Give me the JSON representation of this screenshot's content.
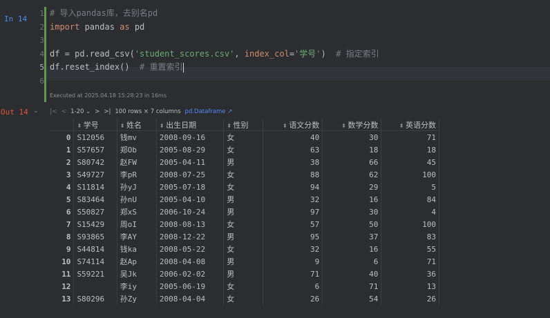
{
  "input_cell": {
    "prompt": "In 14",
    "line_numbers": [
      "1",
      "2",
      "3",
      "4",
      "5",
      "6"
    ],
    "lines": [
      [
        {
          "t": "# 导入pandas库，去别名pd",
          "c": "c-com"
        }
      ],
      [
        {
          "t": "import",
          "c": "c-kw"
        },
        {
          "t": " pandas ",
          "c": "c-norm"
        },
        {
          "t": "as",
          "c": "c-kw"
        },
        {
          "t": " pd",
          "c": "c-norm"
        }
      ],
      [],
      [
        {
          "t": "df = pd.read_csv(",
          "c": "c-norm"
        },
        {
          "t": "'student_scores.csv'",
          "c": "c-str"
        },
        {
          "t": ", ",
          "c": "c-norm"
        },
        {
          "t": "index_col",
          "c": "c-param"
        },
        {
          "t": "=",
          "c": "c-norm"
        },
        {
          "t": "'学号'",
          "c": "c-str"
        },
        {
          "t": ")  ",
          "c": "c-norm"
        },
        {
          "t": "# 指定索引",
          "c": "c-com"
        }
      ],
      [
        {
          "t": "df.reset_index()  ",
          "c": "c-norm"
        },
        {
          "t": "# 重置索引",
          "c": "c-com"
        }
      ],
      []
    ],
    "executed": "Executed at 2025.04.18 15:28:23 in 16ms"
  },
  "output_cell": {
    "prompt": "Out 14",
    "collapse_icon": "chevron-down-icon",
    "toolbar": {
      "first": "|<",
      "prev": "<",
      "page_range": "1-20",
      "next": ">",
      "last": ">|",
      "summary": "100 rows × 7 columns",
      "type_link": "pd.Dataframe ↗"
    },
    "columns": [
      "",
      "学号",
      "姓名",
      "出生日期",
      "性别",
      "语文分数",
      "数学分数",
      "英语分数"
    ],
    "rows": [
      [
        "0",
        "S12056",
        "钱mv",
        "2008-09-16",
        "女",
        "40",
        "30",
        "71"
      ],
      [
        "1",
        "S57657",
        "郑Ob",
        "2005-08-29",
        "女",
        "63",
        "18",
        "18"
      ],
      [
        "2",
        "S80742",
        "赵FW",
        "2005-04-11",
        "男",
        "38",
        "66",
        "45"
      ],
      [
        "3",
        "S49727",
        "李pR",
        "2008-07-25",
        "女",
        "88",
        "62",
        "100"
      ],
      [
        "4",
        "S11814",
        "孙yJ",
        "2005-07-18",
        "女",
        "94",
        "29",
        "5"
      ],
      [
        "5",
        "S83464",
        "孙nU",
        "2005-04-10",
        "男",
        "32",
        "16",
        "84"
      ],
      [
        "6",
        "S50827",
        "郑xS",
        "2006-10-24",
        "男",
        "97",
        "30",
        "4"
      ],
      [
        "7",
        "S15429",
        "周oI",
        "2008-08-13",
        "女",
        "57",
        "50",
        "100"
      ],
      [
        "8",
        "S93865",
        "李AY",
        "2008-12-22",
        "男",
        "95",
        "37",
        "83"
      ],
      [
        "9",
        "S44814",
        "钱ka",
        "2008-05-22",
        "女",
        "32",
        "16",
        "55"
      ],
      [
        "10",
        "S74114",
        "赵Ap",
        "2008-04-08",
        "男",
        "9",
        "6",
        "71"
      ],
      [
        "11",
        "S59221",
        "吴Jk",
        "2006-02-02",
        "男",
        "71",
        "40",
        "36"
      ],
      [
        "12",
        "",
        "李iy",
        "2005-06-19",
        "女",
        "6",
        "71",
        "13"
      ],
      [
        "13",
        "S80296",
        "孙Zy",
        "2008-04-04",
        "女",
        "26",
        "54",
        "26"
      ]
    ]
  },
  "colors": {
    "background": "#2b2d30",
    "in_prompt": "#4a8cf0",
    "out_prompt": "#e0533d",
    "keyword": "#cf8e6d",
    "string": "#6aab73",
    "comment": "#7a7e85",
    "link": "#548af7"
  }
}
